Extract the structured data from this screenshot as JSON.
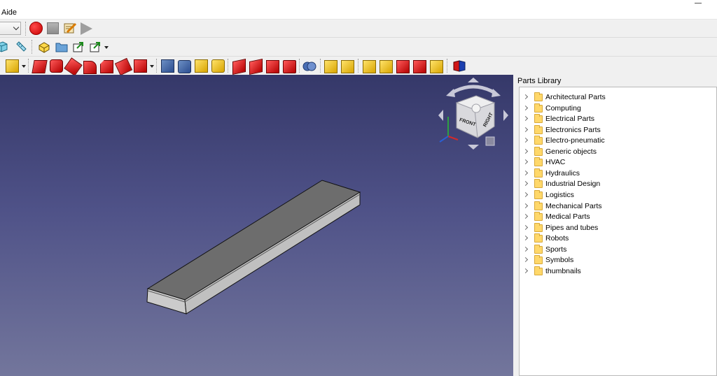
{
  "menubar": {
    "menu_aide": "Aide"
  },
  "macro_toolbar": {
    "workbench_select_value": "",
    "icons": [
      "macro-record-icon",
      "macro-stop-icon",
      "macro-edit-icon",
      "macro-play-icon"
    ]
  },
  "view_toolbar": {
    "icons": [
      "view-cube-icon",
      "measure-ruler-icon",
      "part-yellow-icon",
      "folder-icon",
      "export-icon",
      "export-dropdown-icon"
    ]
  },
  "part_toolbar": {
    "icons": [
      "primitive-yellow-icon",
      "extrude-icon",
      "revolve-icon",
      "mirror-icon",
      "fillet-icon",
      "chamfer-icon",
      "make-face-icon",
      "ruled-surface-icon",
      "loft-icon",
      "sweep-icon",
      "section-icon",
      "cross-sections-icon",
      "offset-icon",
      "thickness-icon",
      "boolean-icon",
      "join-icon",
      "check-geometry-icon",
      "measure-linear-icon",
      "measure-angular-icon",
      "measure-refresh-icon",
      "measure-clear-icon",
      "toggle-3d-icon",
      "toggle-delta-icon",
      "color-icon"
    ]
  },
  "navigation_cube": {
    "face_front": "FRONT",
    "face_right": "RIGHT"
  },
  "colors": {
    "viewport_top": "#353869",
    "viewport_bottom": "#73769c",
    "part_top": "#6d6d6d",
    "part_side": "#cbcbcb",
    "folder": "#ffd86a"
  },
  "parts_library": {
    "title": "Parts Library",
    "items": [
      {
        "label": "Architectural Parts"
      },
      {
        "label": "Computing"
      },
      {
        "label": "Electrical Parts"
      },
      {
        "label": "Electronics Parts"
      },
      {
        "label": "Electro-pneumatic"
      },
      {
        "label": "Generic objects"
      },
      {
        "label": "HVAC"
      },
      {
        "label": "Hydraulics"
      },
      {
        "label": "Industrial Design"
      },
      {
        "label": "Logistics"
      },
      {
        "label": "Mechanical Parts"
      },
      {
        "label": "Medical Parts"
      },
      {
        "label": "Pipes and tubes"
      },
      {
        "label": "Robots"
      },
      {
        "label": "Sports"
      },
      {
        "label": "Symbols"
      },
      {
        "label": "thumbnails"
      }
    ]
  }
}
